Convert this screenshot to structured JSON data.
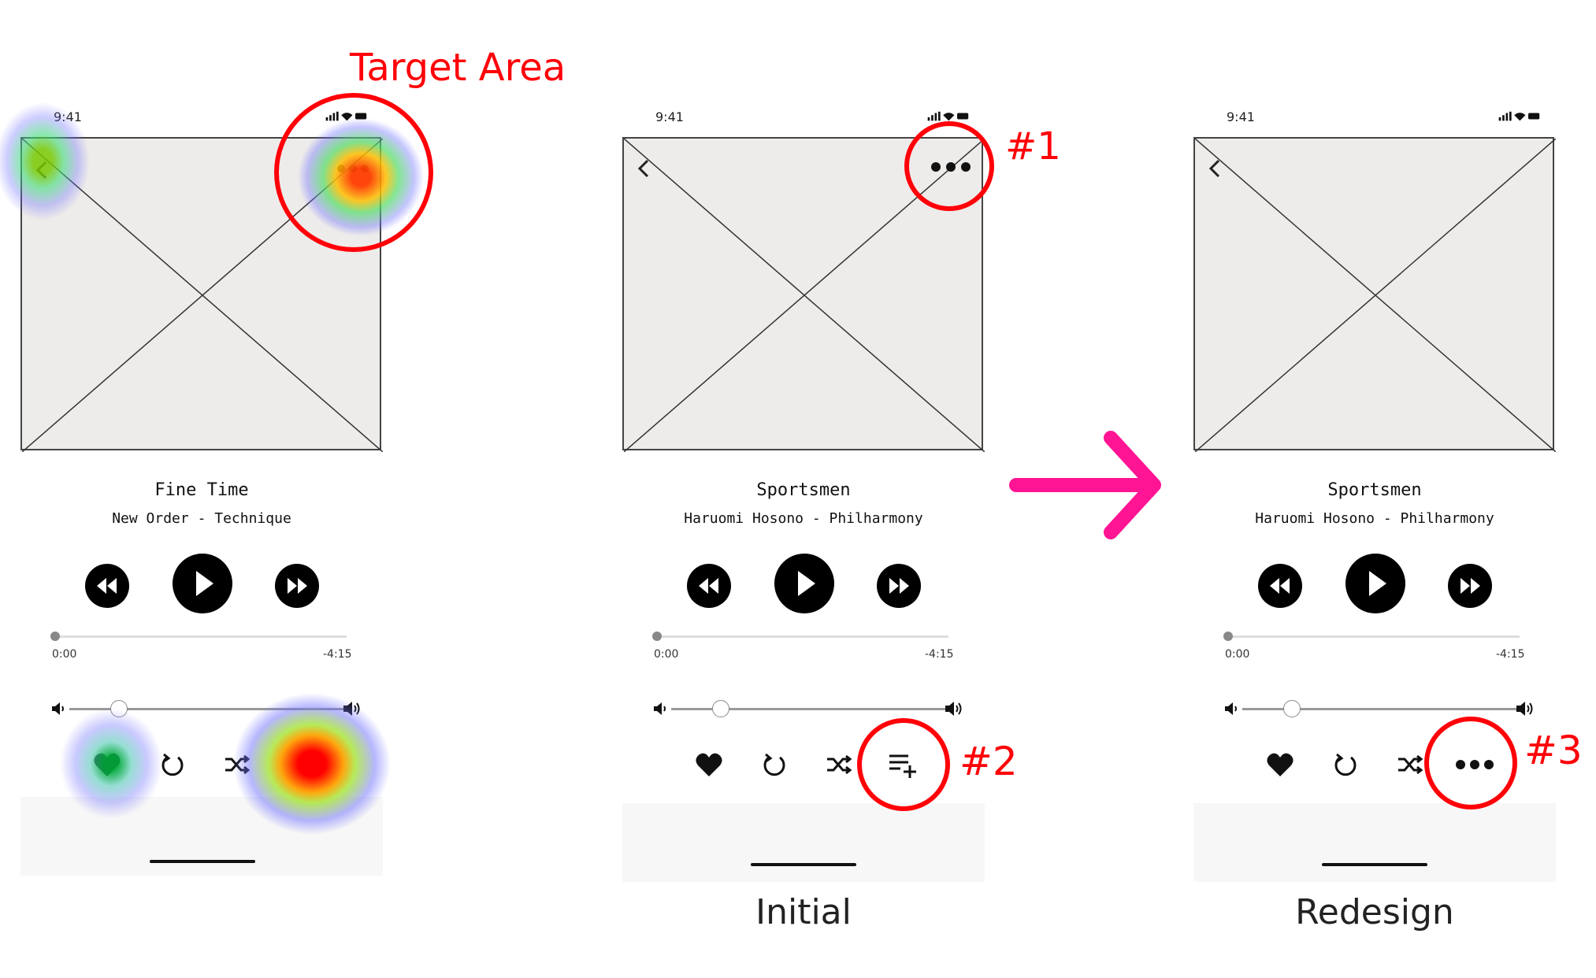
{
  "annotations": {
    "target_area": "Target Area",
    "mark1": "#1",
    "mark2": "#2",
    "mark3": "#3"
  },
  "captions": {
    "initial": "Initial",
    "redesign": "Redesign"
  },
  "screens": [
    {
      "status_time": "9:41",
      "song_title": "Fine Time",
      "song_subtitle": "New Order - Technique",
      "time_start": "0:00",
      "time_end": "-4:15"
    },
    {
      "status_time": "9:41",
      "song_title": "Sportsmen",
      "song_subtitle": "Haruomi Hosono - Philharmony",
      "time_start": "0:00",
      "time_end": "-4:15"
    },
    {
      "status_time": "9:41",
      "song_title": "Sportsmen",
      "song_subtitle": "Haruomi Hosono - Philharmony",
      "time_start": "0:00",
      "time_end": "-4:15"
    }
  ],
  "icons": {
    "back": "chevron-left-icon",
    "more": "more-horizontal-icon",
    "rewind": "rewind-icon",
    "play": "play-icon",
    "fast_forward": "fast-forward-icon",
    "heart": "heart-icon",
    "repeat": "repeat-icon",
    "shuffle": "shuffle-icon",
    "add_to_queue": "playlist-add-icon",
    "volume_low": "volume-low-icon",
    "volume_high": "volume-high-icon",
    "arrow": "arrow-right-icon"
  },
  "colors": {
    "annotation_red": "#ff0008",
    "arrow_pink": "#ff1493",
    "artwork_bg": "#eeecea"
  }
}
